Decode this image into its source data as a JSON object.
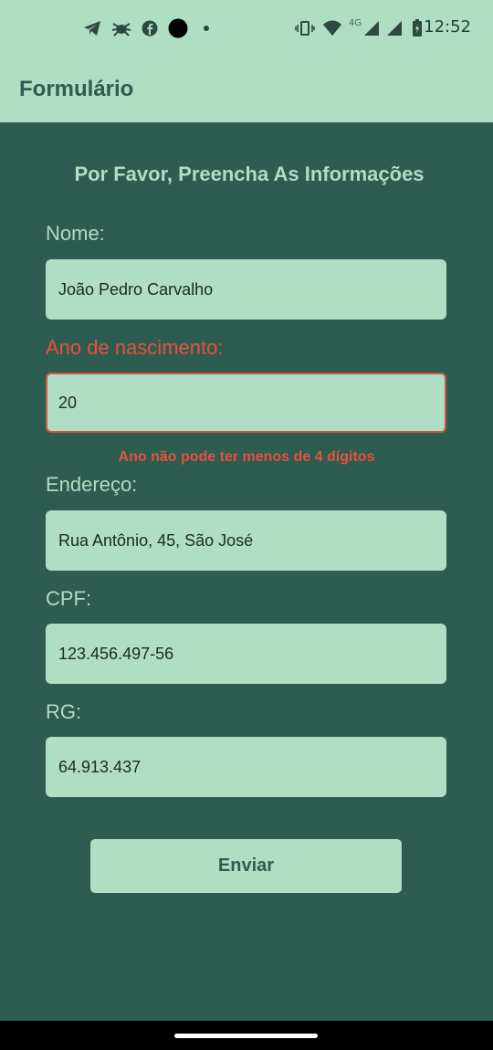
{
  "status_bar": {
    "time": "12:52",
    "network_label": "4G",
    "icons": [
      "telegram-icon",
      "bug-icon",
      "facebook-icon",
      "camera-dot-icon",
      "dot-icon",
      "vibrate-icon",
      "wifi-icon",
      "signal-icon",
      "signal-icon",
      "battery-icon"
    ]
  },
  "app_bar": {
    "title": "Formulário"
  },
  "form": {
    "heading": "Por Favor, Preencha As Informações",
    "name_label": "Nome:",
    "name_value": "João Pedro Carvalho",
    "birth_label": "Ano de nascimento:",
    "birth_value": "20",
    "birth_error": "Ano não pode ter menos de 4 dígitos",
    "address_label": "Endereço:",
    "address_value": "Rua Antônio, 45, São José",
    "cpf_label": "CPF:",
    "cpf_value": "123.456.497-56",
    "rg_label": "RG:",
    "rg_value": "64.913.437",
    "submit_label": "Enviar"
  },
  "colors": {
    "background": "#2d5c51",
    "accent": "#aedec3",
    "error": "#e8513a"
  }
}
